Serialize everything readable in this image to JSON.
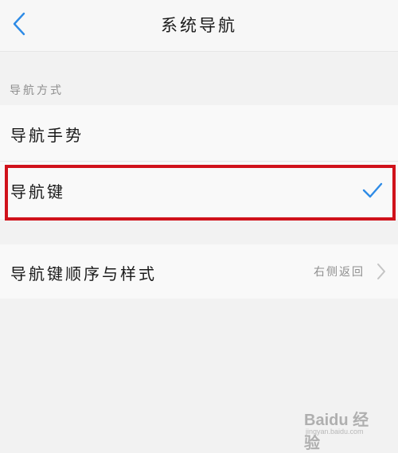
{
  "header": {
    "title": "系统导航",
    "back_icon": "chevron-left-icon"
  },
  "section": {
    "title": "导航方式"
  },
  "options": [
    {
      "label": "导航手势",
      "selected": false
    },
    {
      "label": "导航键",
      "selected": true
    }
  ],
  "settings": {
    "order_label": "导航键顺序与样式",
    "order_value": "右侧返回"
  },
  "colors": {
    "accent": "#2e8be6",
    "highlight": "#d0121b",
    "background": "#f2f2f2",
    "row_background": "#f9f9f9"
  },
  "watermark": {
    "logo": "Baidu 经验",
    "url": "jingyan.baidu.com"
  }
}
